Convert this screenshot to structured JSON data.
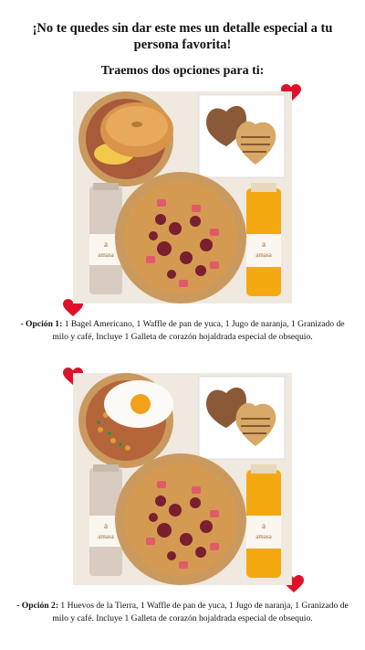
{
  "headline": "¡No te quedes sin dar este mes un detalle especial a tu persona favorita!",
  "subline": "Traemos dos opciones para ti:",
  "options": [
    {
      "label": "- Opción 1:",
      "description": " 1 Bagel Americano, 1 Waffle de pan de yuca, 1 Jugo de naranja, 1 Granizado de milo y café, Incluye 1 Galleta de corazón hojaldrada especial de obsequio."
    },
    {
      "label": "- Opción 2:",
      "description": " 1 Huevos de la Tierra, 1 Waffle de pan de yuca, 1 Jugo de naranja, 1 Granizado de milo y café. Incluye 1 Galleta de corazón hojaldrada especial de obsequio."
    }
  ],
  "bottle_labels": [
    "a",
    "amasa"
  ],
  "colors": {
    "heart": "#e0102a",
    "box": "#f3eee6",
    "kraft": "#c9995e",
    "juice": "#f3a90f"
  }
}
